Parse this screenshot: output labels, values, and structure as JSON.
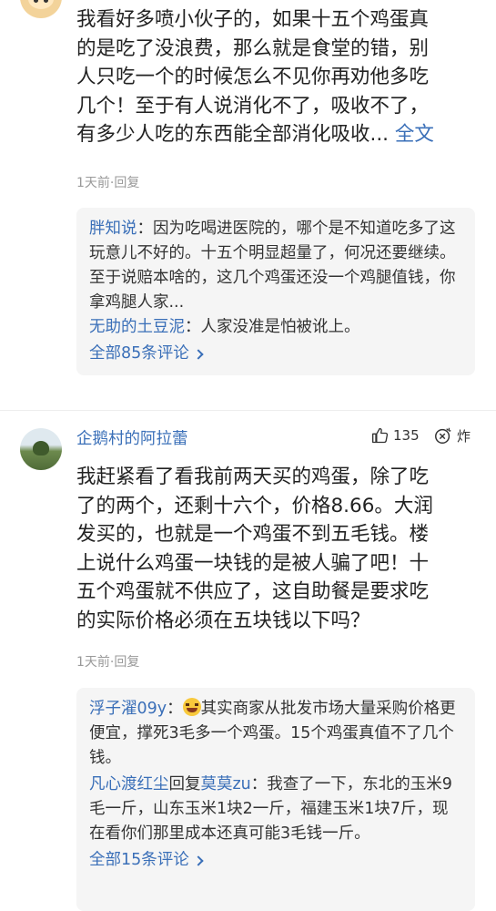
{
  "comment1": {
    "lines": [
      "我看好多喷小伙子的，如果十五个鸡蛋真",
      "的是吃了没浪费，那么就是食堂的错，别",
      "人只吃一个的时候怎么不见你再劝他多吃",
      "几个！至于有人说消化不了，吸收不了，",
      "有多少人吃的东西能全部消化吸收..."
    ],
    "full_link": " 全文",
    "meta": "1天前·回复",
    "replies": [
      {
        "name": "胖知说",
        "text": "：因为吃喝进医院的，哪个是不知道吃多了这玩意儿不好的。十五个明显超量了，何况还要继续。至于说赔本啥的，这几个鸡蛋还没一个鸡腿值钱，你拿鸡腿人家..."
      },
      {
        "name": "无助的土豆泥",
        "text": "：人家没准是怕被讹上。"
      }
    ],
    "more_label": "全部85条评论"
  },
  "comment2": {
    "username": "企鹅村的阿拉蕾",
    "likes": "135",
    "fire_label": "炸",
    "lines": [
      "我赶紧看了看我前两天买的鸡蛋，除了吃",
      "了的两个，还剩十六个，价格8.66。大润",
      "发买的，也就是一个鸡蛋不到五毛钱。楼",
      "上说什么鸡蛋一块钱的是被人骗了吧！十",
      "五个鸡蛋就不供应了，这自助餐是要求吃",
      "的实际价格必须在五块钱以下吗？"
    ],
    "meta": "1天前·回复",
    "replies": [
      {
        "name": "浮子濯09y",
        "text": "其实商家从批发市场大量采购价格更便宜，撑死3毛多一个鸡蛋。15个鸡蛋真值不了几个钱。"
      },
      {
        "name": "凡心渡红尘",
        "reply_word": "回复",
        "target": "莫莫zu",
        "text": "：我查了一下，东北的玉米9毛一斤，山东玉米1块2一斤，福建玉米1块7斤，现在看你们那里成本还真可能3毛钱一斤。"
      }
    ],
    "more_label": "全部15条评论"
  },
  "icons": [
    "avatar",
    "thumb-up-icon",
    "fire-icon",
    "laugh-emoji-icon",
    "chevron-right-icon"
  ],
  "colors": {
    "link": "#3a6fb8",
    "meta": "#999999",
    "reply_bg": "#f5f5f5"
  }
}
